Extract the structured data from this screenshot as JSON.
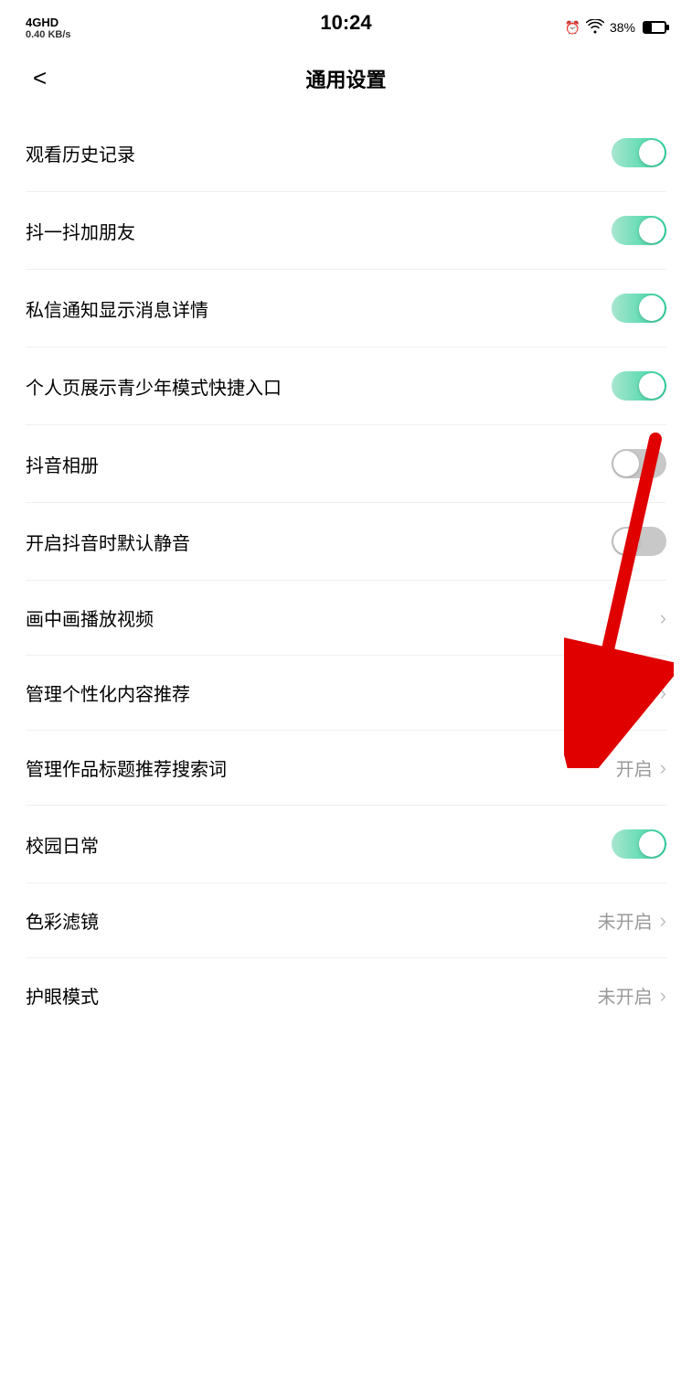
{
  "statusBar": {
    "network": "4GHD",
    "signal": "↑↓",
    "speed": "0.40 KB/s",
    "time": "10:24",
    "alarm": "⏰",
    "wifi": "WiFi",
    "battery": "38%"
  },
  "header": {
    "backLabel": "<",
    "title": "通用设置"
  },
  "settings": {
    "items": [
      {
        "id": "watch-history",
        "label": "观看历史记录",
        "type": "toggle",
        "state": "on",
        "value": ""
      },
      {
        "id": "shake-friend",
        "label": "抖一抖加朋友",
        "type": "toggle",
        "state": "on",
        "value": ""
      },
      {
        "id": "msg-notify",
        "label": "私信通知显示消息详情",
        "type": "toggle",
        "state": "on",
        "value": ""
      },
      {
        "id": "youth-mode",
        "label": "个人页展示青少年模式快捷入口",
        "type": "toggle",
        "state": "on",
        "value": ""
      },
      {
        "id": "album",
        "label": "抖音相册",
        "type": "toggle",
        "state": "off",
        "value": ""
      },
      {
        "id": "default-mute",
        "label": "开启抖音时默认静音",
        "type": "toggle",
        "state": "off",
        "value": ""
      },
      {
        "id": "pip",
        "label": "画中画播放视频",
        "type": "chevron",
        "state": "",
        "value": ""
      },
      {
        "id": "recommend-mgmt",
        "label": "管理个性化内容推荐",
        "type": "chevron",
        "state": "",
        "value": ""
      },
      {
        "id": "search-word",
        "label": "管理作品标题推荐搜索词",
        "type": "chevron-value",
        "state": "",
        "value": "开启"
      },
      {
        "id": "campus",
        "label": "校园日常",
        "type": "toggle",
        "state": "on",
        "value": ""
      },
      {
        "id": "color-filter",
        "label": "色彩滤镜",
        "type": "chevron-value",
        "state": "",
        "value": "未开启"
      },
      {
        "id": "eye-protect",
        "label": "护眼模式",
        "type": "chevron-value",
        "state": "",
        "value": "未开启"
      }
    ]
  }
}
